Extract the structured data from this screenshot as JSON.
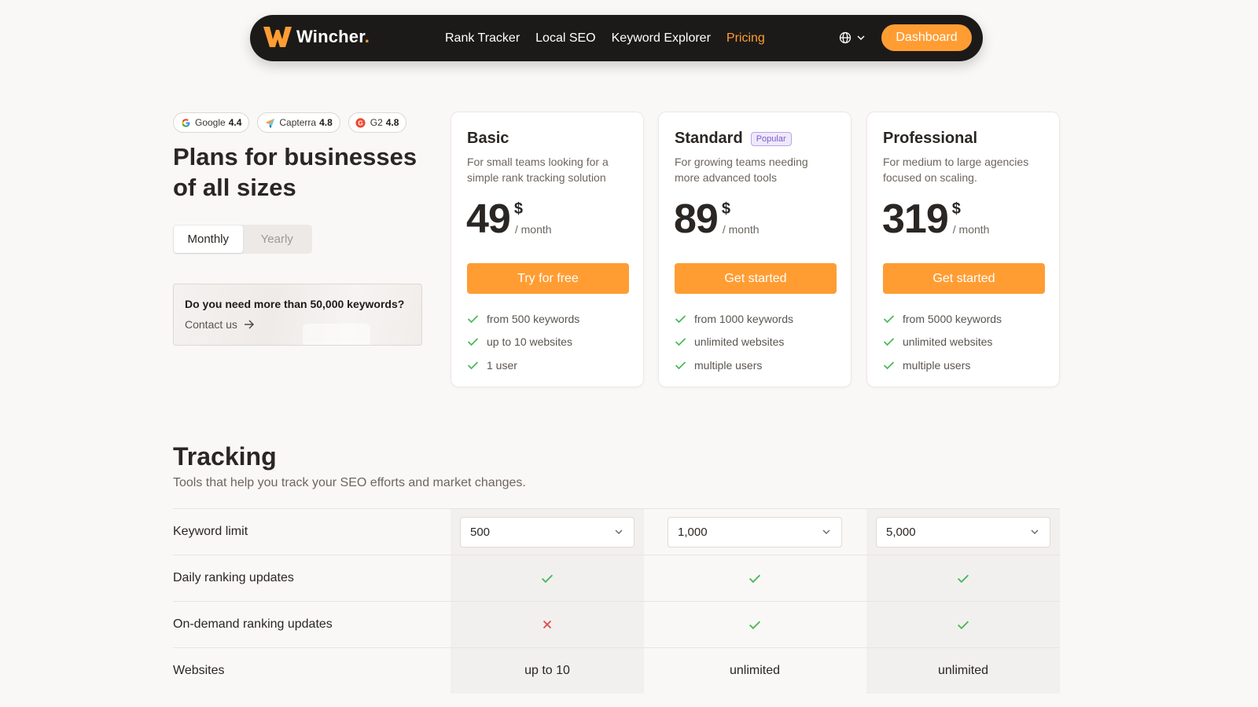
{
  "nav": {
    "brand": "Wincher",
    "brand_dot": ".",
    "links": [
      "Rank Tracker",
      "Local SEO",
      "Keyword Explorer",
      "Pricing"
    ],
    "active_link": "Pricing",
    "dashboard_label": "Dashboard",
    "language_icon": "globe-icon"
  },
  "ratings": [
    {
      "source": "Google",
      "score": "4.4"
    },
    {
      "source": "Capterra",
      "score": "4.8"
    },
    {
      "source": "G2",
      "score": "4.8"
    }
  ],
  "hero": {
    "headline": "Plans for businesses of all sizes",
    "billing_toggle": {
      "options": [
        "Monthly",
        "Yearly"
      ],
      "selected": "Monthly"
    },
    "contact": {
      "question": "Do you need more than 50,000 keywords?",
      "link": "Contact us"
    }
  },
  "plans": [
    {
      "name": "Basic",
      "badge": "",
      "description": "For small teams looking for a simple rank tracking solution",
      "price": "49",
      "currency": "$",
      "period": "/ month",
      "cta": "Try for free",
      "features": [
        "from 500 keywords",
        "up to 10 websites",
        "1 user"
      ]
    },
    {
      "name": "Standard",
      "badge": "Popular",
      "description": "For growing teams needing more advanced tools",
      "price": "89",
      "currency": "$",
      "period": "/ month",
      "cta": "Get started",
      "features": [
        "from 1000 keywords",
        "unlimited websites",
        "multiple users"
      ]
    },
    {
      "name": "Professional",
      "badge": "",
      "description": "For medium to large agencies focused on scaling.",
      "price": "319",
      "currency": "$",
      "period": "/ month",
      "cta": "Get started",
      "features": [
        "from 5000 keywords",
        "unlimited websites",
        "multiple users"
      ]
    }
  ],
  "tracking": {
    "title": "Tracking",
    "subtitle": "Tools that help you track your SEO efforts and market changes.",
    "rows": [
      {
        "label": "Keyword limit",
        "type": "select",
        "values": [
          "500",
          "1,000",
          "5,000"
        ]
      },
      {
        "label": "Daily ranking updates",
        "type": "bool",
        "values": [
          true,
          true,
          true
        ]
      },
      {
        "label": "On-demand ranking updates",
        "type": "bool",
        "values": [
          false,
          true,
          true
        ]
      },
      {
        "label": "Websites",
        "type": "text",
        "values": [
          "up to 10",
          "unlimited",
          "unlimited"
        ]
      }
    ]
  },
  "colors": {
    "accent": "#ff9d33",
    "nav_bg": "#1c1a19",
    "check": "#4cb85c",
    "cross": "#e5484d",
    "badge": "#7b5cc9"
  }
}
